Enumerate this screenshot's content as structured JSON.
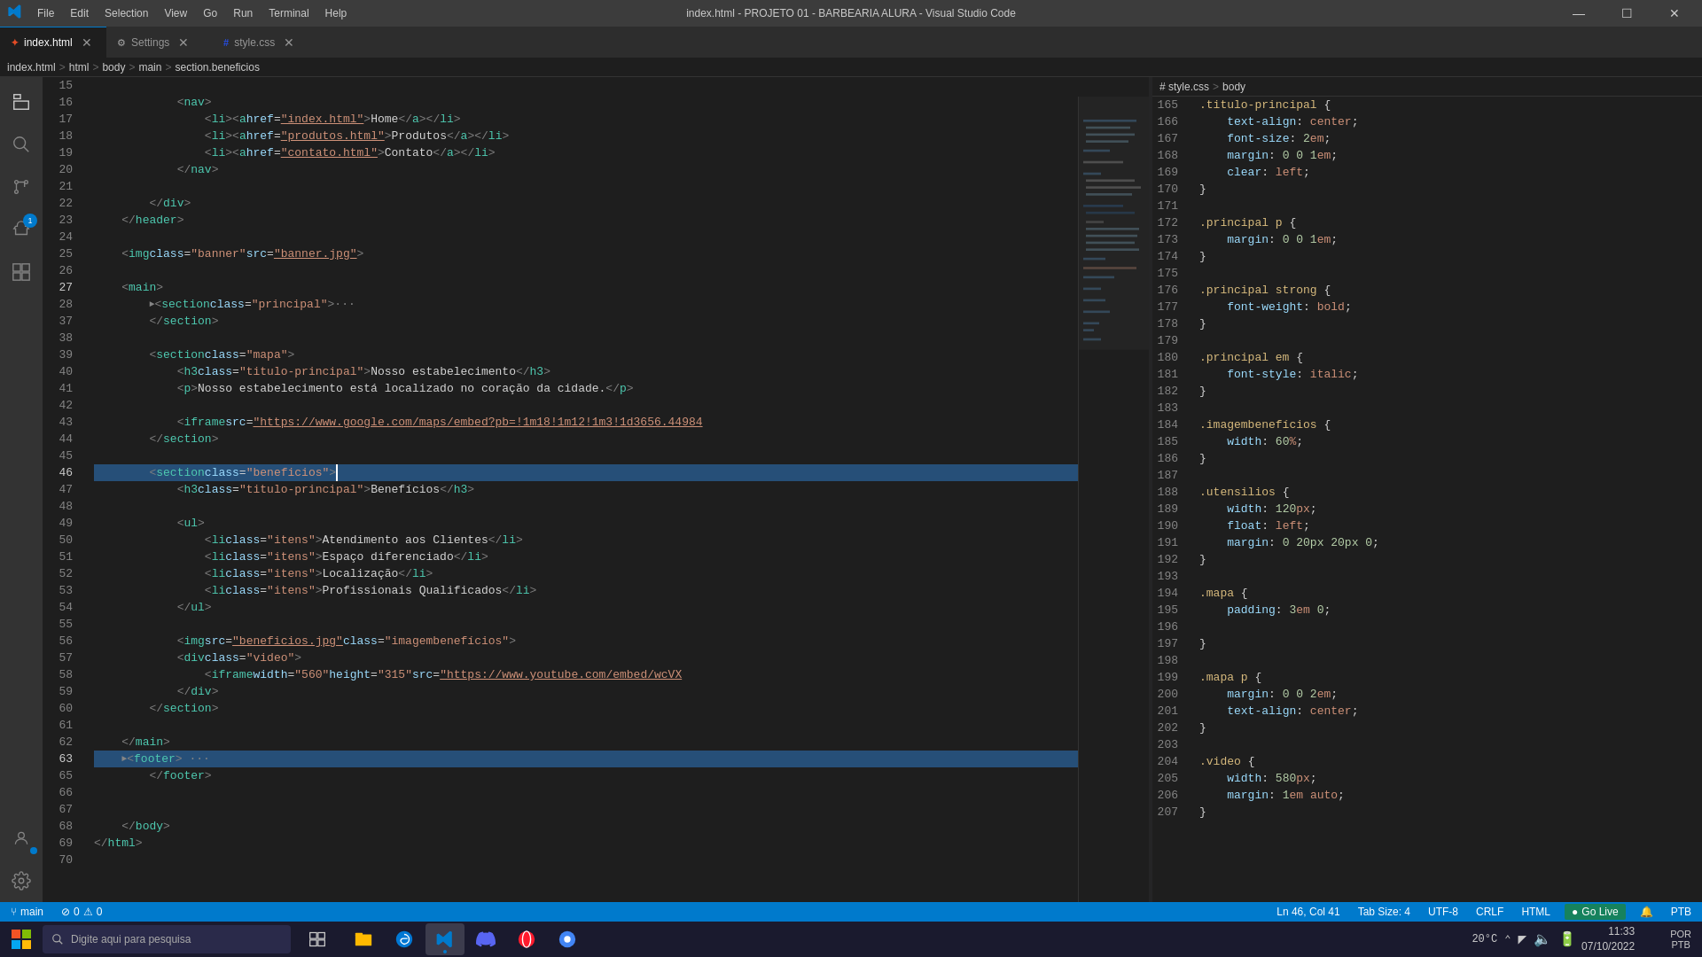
{
  "titleBar": {
    "title": "index.html - PROJETO 01 - BARBEARIA ALURA - Visual Studio Code",
    "menus": [
      "File",
      "Edit",
      "Selection",
      "View",
      "Go",
      "Run",
      "Terminal",
      "Help"
    ]
  },
  "tabs": [
    {
      "label": "index.html",
      "type": "html",
      "active": true,
      "modified": false
    },
    {
      "label": "Settings",
      "type": "settings",
      "active": false,
      "modified": false
    },
    {
      "label": "style.css",
      "type": "css",
      "active": false,
      "modified": false
    }
  ],
  "breadcrumb": {
    "htmlPath": "index.html > html > body > main > section.beneficios",
    "cssPath": "# style.css > body"
  },
  "htmlLines": [
    {
      "num": "15",
      "content": ""
    },
    {
      "num": "16",
      "content": "            <nav>"
    },
    {
      "num": "17",
      "content": "                <li><a href=\"index.html\">Home</a></li>"
    },
    {
      "num": "18",
      "content": "                <li><a href=\"produtos.html\">Produtos</a></li>"
    },
    {
      "num": "19",
      "content": "                <li><a href=\"contato.html\">Contato</a></li>"
    },
    {
      "num": "20",
      "content": "            </nav>"
    },
    {
      "num": "21",
      "content": ""
    },
    {
      "num": "22",
      "content": "        </div>"
    },
    {
      "num": "23",
      "content": "    </header>"
    },
    {
      "num": "24",
      "content": ""
    },
    {
      "num": "25",
      "content": "    <img class=\"banner\" src=\"banner.jpg\">"
    },
    {
      "num": "26",
      "content": ""
    },
    {
      "num": "27",
      "content": "    <main>"
    },
    {
      "num": "28",
      "content": "        <section class=\"principal\">..."
    },
    {
      "num": "37",
      "content": "        </section>"
    },
    {
      "num": "38",
      "content": ""
    },
    {
      "num": "39",
      "content": "        <section class=\"mapa\">"
    },
    {
      "num": "40",
      "content": "            <h3 class=\"titulo-principal\">Nosso estabelecimento</h3>"
    },
    {
      "num": "41",
      "content": "            <p>Nosso estabelecimento está localizado no coração da cidade.</p>"
    },
    {
      "num": "42",
      "content": ""
    },
    {
      "num": "43",
      "content": "            <iframe src=\"https://www.google.com/maps/embed?pb=!1m18!1m12!1m3!1d3656.44984"
    },
    {
      "num": "44",
      "content": "        </section>"
    },
    {
      "num": "45",
      "content": ""
    },
    {
      "num": "46",
      "content": "        <section class=\"beneficios\">|"
    },
    {
      "num": "47",
      "content": "            <h3 class=\"titulo-principal\">Benefícios</h3>"
    },
    {
      "num": "48",
      "content": ""
    },
    {
      "num": "49",
      "content": "            <ul>"
    },
    {
      "num": "50",
      "content": "                <li class=\"itens\">Atendimento aos Clientes</li>"
    },
    {
      "num": "51",
      "content": "                <li class=\"itens\">Espaço diferenciado</li>"
    },
    {
      "num": "52",
      "content": "                <li class=\"itens\">Localização</li>"
    },
    {
      "num": "53",
      "content": "                <li class=\"itens\">Profissionais Qualificados</li>"
    },
    {
      "num": "54",
      "content": "            </ul>"
    },
    {
      "num": "55",
      "content": ""
    },
    {
      "num": "56",
      "content": "            <img src=\"beneficios.jpg\" class=\"imagembenefícios\">"
    },
    {
      "num": "57",
      "content": "            <div class=\"video\">"
    },
    {
      "num": "58",
      "content": "                <iframe width=\"560\" height=\"315\" src=\"https://www.youtube.com/embed/wcVX"
    },
    {
      "num": "59",
      "content": "            </div>"
    },
    {
      "num": "60",
      "content": "        </section>"
    },
    {
      "num": "61",
      "content": ""
    },
    {
      "num": "62",
      "content": "    </main>"
    },
    {
      "num": "63",
      "content": "    <footer> ..."
    },
    {
      "num": "65",
      "content": "        </footer>"
    },
    {
      "num": "66",
      "content": ""
    },
    {
      "num": "67",
      "content": ""
    },
    {
      "num": "68",
      "content": "    </body>"
    },
    {
      "num": "69",
      "content": "</html>"
    },
    {
      "num": "70",
      "content": ""
    }
  ],
  "cssLines": [
    {
      "num": "165",
      "content": ".titulo-principal {"
    },
    {
      "num": "166",
      "content": "    text-align: center;"
    },
    {
      "num": "167",
      "content": "    font-size: 2em;"
    },
    {
      "num": "168",
      "content": "    margin: 0 0 1em;"
    },
    {
      "num": "169",
      "content": "    clear: left;"
    },
    {
      "num": "170",
      "content": "}"
    },
    {
      "num": "171",
      "content": ""
    },
    {
      "num": "172",
      "content": ".principal p {"
    },
    {
      "num": "173",
      "content": "    margin: 0 0 1em;"
    },
    {
      "num": "174",
      "content": "}"
    },
    {
      "num": "175",
      "content": ""
    },
    {
      "num": "176",
      "content": ".principal strong {"
    },
    {
      "num": "177",
      "content": "    font-weight: bold;"
    },
    {
      "num": "178",
      "content": "}"
    },
    {
      "num": "179",
      "content": ""
    },
    {
      "num": "180",
      "content": ".principal em {"
    },
    {
      "num": "181",
      "content": "    font-style: italic;"
    },
    {
      "num": "182",
      "content": "}"
    },
    {
      "num": "183",
      "content": ""
    },
    {
      "num": "184",
      "content": ".imagembenefícios {"
    },
    {
      "num": "185",
      "content": "    width: 60%;"
    },
    {
      "num": "186",
      "content": "}"
    },
    {
      "num": "187",
      "content": ""
    },
    {
      "num": "188",
      "content": ".utensilios {"
    },
    {
      "num": "189",
      "content": "    width: 120px;"
    },
    {
      "num": "190",
      "content": "    float: left;"
    },
    {
      "num": "191",
      "content": "    margin: 0 20px 20px 0;"
    },
    {
      "num": "192",
      "content": "}"
    },
    {
      "num": "193",
      "content": ""
    },
    {
      "num": "194",
      "content": ".mapa {"
    },
    {
      "num": "195",
      "content": "    padding: 3em 0;"
    },
    {
      "num": "196",
      "content": ""
    },
    {
      "num": "197",
      "content": "}"
    },
    {
      "num": "198",
      "content": ""
    },
    {
      "num": "199",
      "content": ".mapa p {"
    },
    {
      "num": "200",
      "content": "    margin: 0 0 2em;"
    },
    {
      "num": "201",
      "content": "    text-align: center;"
    },
    {
      "num": "202",
      "content": "}"
    },
    {
      "num": "203",
      "content": ""
    },
    {
      "num": "204",
      "content": ".video {"
    },
    {
      "num": "205",
      "content": "    width: 580px;"
    },
    {
      "num": "206",
      "content": "    margin: 1em auto;"
    },
    {
      "num": "207",
      "content": "}"
    }
  ],
  "statusBar": {
    "branch": "main",
    "errors": "0",
    "warnings": "0",
    "position": "Ln 46, Col 41",
    "tabSize": "Tab Size: 4",
    "encoding": "UTF-8",
    "lineEnding": "CRLF",
    "language": "HTML",
    "goLive": "Go Live",
    "notifications": "1",
    "port": "PTB"
  },
  "taskbar": {
    "searchPlaceholder": "Digite aqui para pesquisa",
    "time": "11:33",
    "date": "07/10/2022",
    "temperature": "20°C",
    "language": "POR"
  },
  "activityBar": {
    "items": [
      "explorer",
      "search",
      "git",
      "debug",
      "extensions"
    ],
    "badge": "1"
  }
}
